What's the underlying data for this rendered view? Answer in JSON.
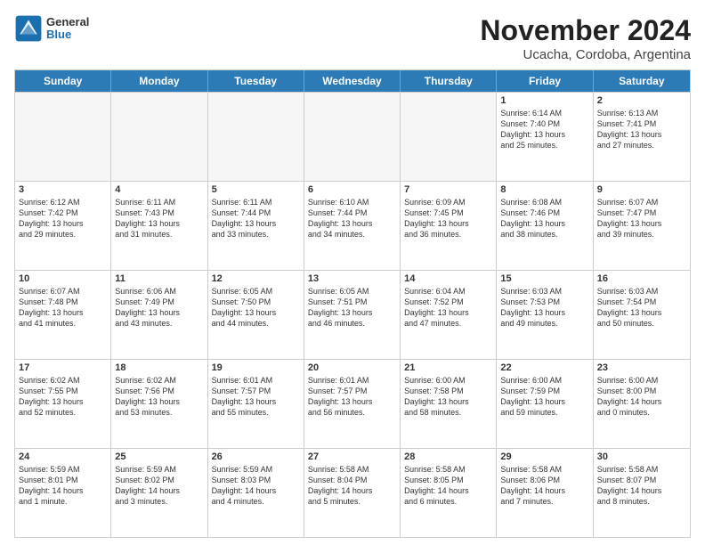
{
  "logo": {
    "general": "General",
    "blue": "Blue"
  },
  "header": {
    "month": "November 2024",
    "location": "Ucacha, Cordoba, Argentina"
  },
  "weekdays": [
    "Sunday",
    "Monday",
    "Tuesday",
    "Wednesday",
    "Thursday",
    "Friday",
    "Saturday"
  ],
  "rows": [
    [
      {
        "day": "",
        "info": "",
        "empty": true
      },
      {
        "day": "",
        "info": "",
        "empty": true
      },
      {
        "day": "",
        "info": "",
        "empty": true
      },
      {
        "day": "",
        "info": "",
        "empty": true
      },
      {
        "day": "",
        "info": "",
        "empty": true
      },
      {
        "day": "1",
        "info": "Sunrise: 6:14 AM\nSunset: 7:40 PM\nDaylight: 13 hours\nand 25 minutes.",
        "empty": false
      },
      {
        "day": "2",
        "info": "Sunrise: 6:13 AM\nSunset: 7:41 PM\nDaylight: 13 hours\nand 27 minutes.",
        "empty": false
      }
    ],
    [
      {
        "day": "3",
        "info": "Sunrise: 6:12 AM\nSunset: 7:42 PM\nDaylight: 13 hours\nand 29 minutes.",
        "empty": false
      },
      {
        "day": "4",
        "info": "Sunrise: 6:11 AM\nSunset: 7:43 PM\nDaylight: 13 hours\nand 31 minutes.",
        "empty": false
      },
      {
        "day": "5",
        "info": "Sunrise: 6:11 AM\nSunset: 7:44 PM\nDaylight: 13 hours\nand 33 minutes.",
        "empty": false
      },
      {
        "day": "6",
        "info": "Sunrise: 6:10 AM\nSunset: 7:44 PM\nDaylight: 13 hours\nand 34 minutes.",
        "empty": false
      },
      {
        "day": "7",
        "info": "Sunrise: 6:09 AM\nSunset: 7:45 PM\nDaylight: 13 hours\nand 36 minutes.",
        "empty": false
      },
      {
        "day": "8",
        "info": "Sunrise: 6:08 AM\nSunset: 7:46 PM\nDaylight: 13 hours\nand 38 minutes.",
        "empty": false
      },
      {
        "day": "9",
        "info": "Sunrise: 6:07 AM\nSunset: 7:47 PM\nDaylight: 13 hours\nand 39 minutes.",
        "empty": false
      }
    ],
    [
      {
        "day": "10",
        "info": "Sunrise: 6:07 AM\nSunset: 7:48 PM\nDaylight: 13 hours\nand 41 minutes.",
        "empty": false
      },
      {
        "day": "11",
        "info": "Sunrise: 6:06 AM\nSunset: 7:49 PM\nDaylight: 13 hours\nand 43 minutes.",
        "empty": false
      },
      {
        "day": "12",
        "info": "Sunrise: 6:05 AM\nSunset: 7:50 PM\nDaylight: 13 hours\nand 44 minutes.",
        "empty": false
      },
      {
        "day": "13",
        "info": "Sunrise: 6:05 AM\nSunset: 7:51 PM\nDaylight: 13 hours\nand 46 minutes.",
        "empty": false
      },
      {
        "day": "14",
        "info": "Sunrise: 6:04 AM\nSunset: 7:52 PM\nDaylight: 13 hours\nand 47 minutes.",
        "empty": false
      },
      {
        "day": "15",
        "info": "Sunrise: 6:03 AM\nSunset: 7:53 PM\nDaylight: 13 hours\nand 49 minutes.",
        "empty": false
      },
      {
        "day": "16",
        "info": "Sunrise: 6:03 AM\nSunset: 7:54 PM\nDaylight: 13 hours\nand 50 minutes.",
        "empty": false
      }
    ],
    [
      {
        "day": "17",
        "info": "Sunrise: 6:02 AM\nSunset: 7:55 PM\nDaylight: 13 hours\nand 52 minutes.",
        "empty": false
      },
      {
        "day": "18",
        "info": "Sunrise: 6:02 AM\nSunset: 7:56 PM\nDaylight: 13 hours\nand 53 minutes.",
        "empty": false
      },
      {
        "day": "19",
        "info": "Sunrise: 6:01 AM\nSunset: 7:57 PM\nDaylight: 13 hours\nand 55 minutes.",
        "empty": false
      },
      {
        "day": "20",
        "info": "Sunrise: 6:01 AM\nSunset: 7:57 PM\nDaylight: 13 hours\nand 56 minutes.",
        "empty": false
      },
      {
        "day": "21",
        "info": "Sunrise: 6:00 AM\nSunset: 7:58 PM\nDaylight: 13 hours\nand 58 minutes.",
        "empty": false
      },
      {
        "day": "22",
        "info": "Sunrise: 6:00 AM\nSunset: 7:59 PM\nDaylight: 13 hours\nand 59 minutes.",
        "empty": false
      },
      {
        "day": "23",
        "info": "Sunrise: 6:00 AM\nSunset: 8:00 PM\nDaylight: 14 hours\nand 0 minutes.",
        "empty": false
      }
    ],
    [
      {
        "day": "24",
        "info": "Sunrise: 5:59 AM\nSunset: 8:01 PM\nDaylight: 14 hours\nand 1 minute.",
        "empty": false
      },
      {
        "day": "25",
        "info": "Sunrise: 5:59 AM\nSunset: 8:02 PM\nDaylight: 14 hours\nand 3 minutes.",
        "empty": false
      },
      {
        "day": "26",
        "info": "Sunrise: 5:59 AM\nSunset: 8:03 PM\nDaylight: 14 hours\nand 4 minutes.",
        "empty": false
      },
      {
        "day": "27",
        "info": "Sunrise: 5:58 AM\nSunset: 8:04 PM\nDaylight: 14 hours\nand 5 minutes.",
        "empty": false
      },
      {
        "day": "28",
        "info": "Sunrise: 5:58 AM\nSunset: 8:05 PM\nDaylight: 14 hours\nand 6 minutes.",
        "empty": false
      },
      {
        "day": "29",
        "info": "Sunrise: 5:58 AM\nSunset: 8:06 PM\nDaylight: 14 hours\nand 7 minutes.",
        "empty": false
      },
      {
        "day": "30",
        "info": "Sunrise: 5:58 AM\nSunset: 8:07 PM\nDaylight: 14 hours\nand 8 minutes.",
        "empty": false
      }
    ]
  ]
}
